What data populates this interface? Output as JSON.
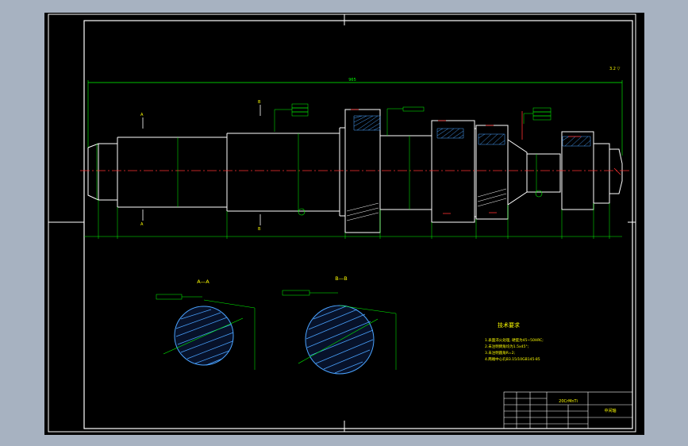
{
  "drawing": {
    "overall_dim": "965",
    "section_a_title": "A—A",
    "section_b_title": "B—B",
    "cut_marks": [
      "A",
      "A",
      "B",
      "B"
    ],
    "roughness_top_right": "3.2 ▽",
    "tech_title": "技术要求",
    "tech_items": [
      "1.表面淬火处理, 硬度为45~50HRC;",
      "2.未注明倒角均为1.5x45°;",
      "3.未注明圆角R=2;",
      "4.两端中心孔B3.15/10GB145-85"
    ],
    "title_block": {
      "material": "20CrMnTi",
      "part_name": "中间轴"
    },
    "colors": {
      "background": "#000000",
      "outline": "#ffffff",
      "dimension": "#00ff00",
      "centerline": "#ff0000",
      "hatch": "#4aa3ff",
      "text_yellow": "#ffff00"
    }
  }
}
